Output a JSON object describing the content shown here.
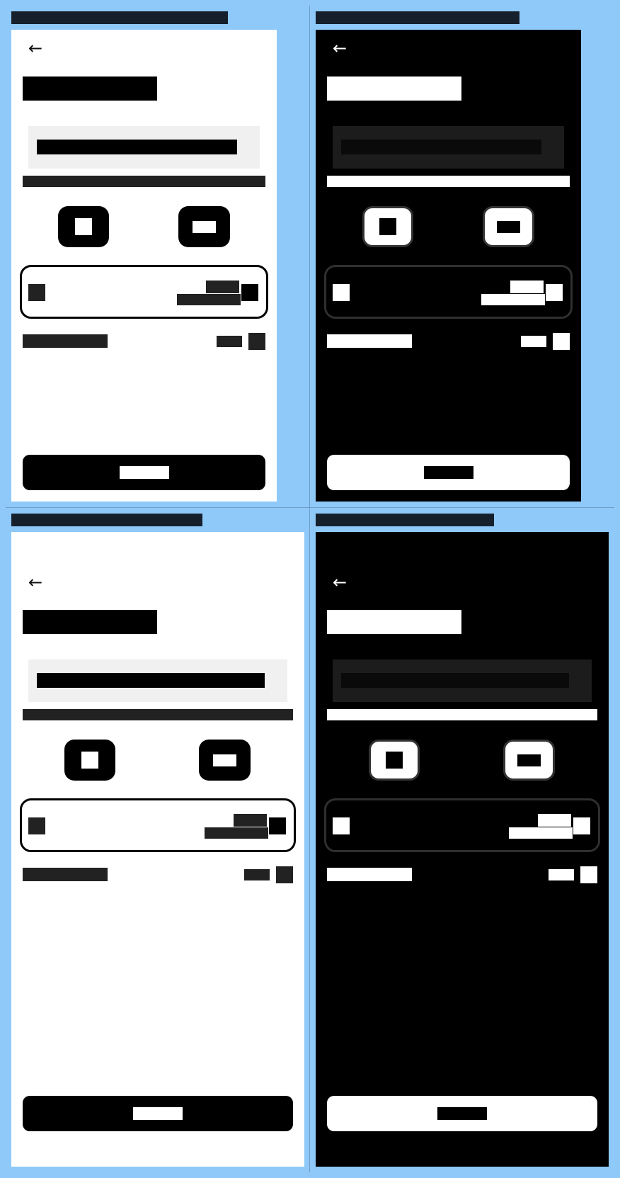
{
  "screens": [
    {
      "id": "phone-light",
      "theme": "light",
      "back_glyph": "←"
    },
    {
      "id": "phone-dark",
      "theme": "dark",
      "back_glyph": "←"
    },
    {
      "id": "tablet-light",
      "theme": "light",
      "back_glyph": "←"
    },
    {
      "id": "tablet-dark",
      "theme": "dark",
      "back_glyph": "←"
    }
  ],
  "icons": {
    "back": "arrow-left-icon"
  },
  "colors": {
    "background": "#8FC9F9",
    "light_surface": "#FFFFFF",
    "dark_surface": "#000000"
  }
}
